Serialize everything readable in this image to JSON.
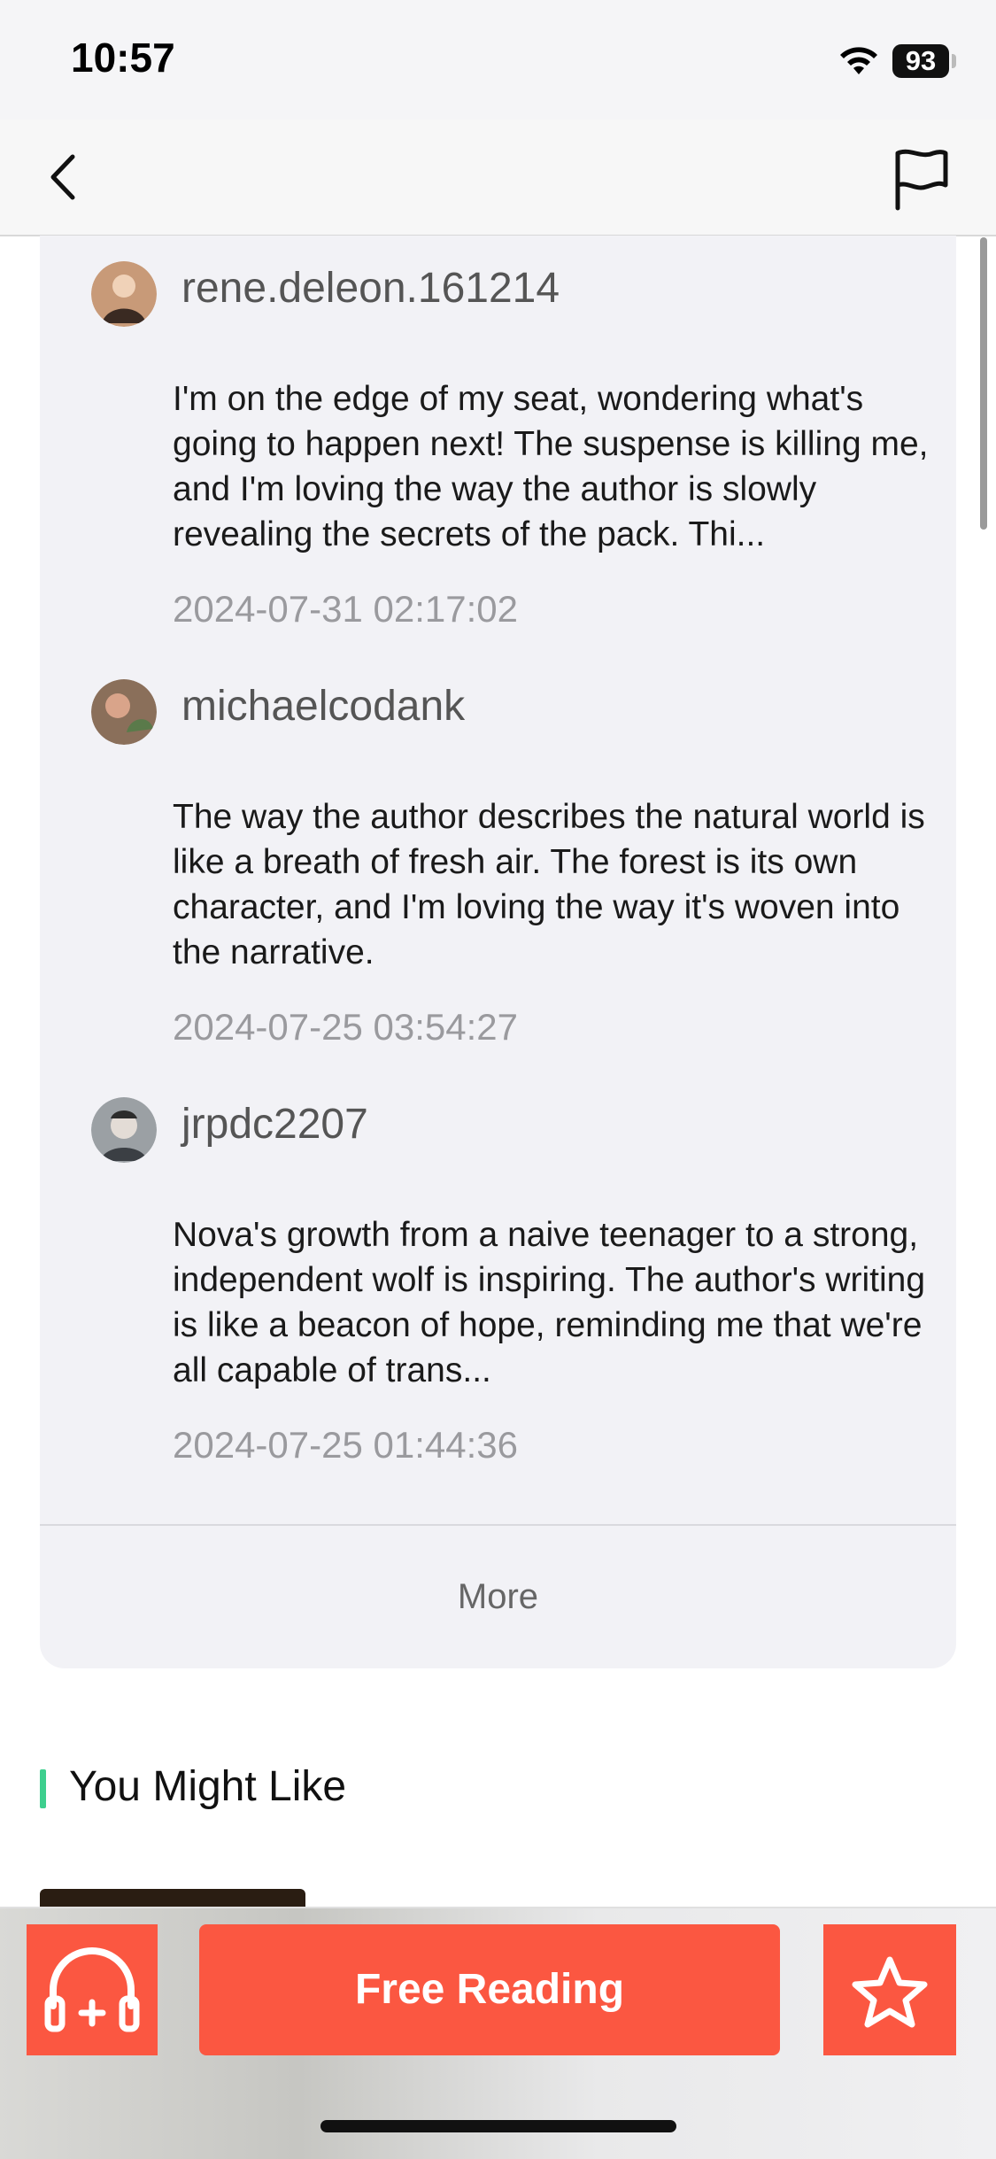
{
  "status_bar": {
    "time": "10:57",
    "battery": "93"
  },
  "comments": [
    {
      "username": "rene.deleon.161214",
      "text": "I'm on the edge of my seat, wondering what's going to happen next! The suspense is killing me, and I'm loving the way the author is slowly revealing the secrets of the pack. Thi...",
      "time": "2024-07-31 02:17:02",
      "avatar_color": "#c89a78"
    },
    {
      "username": "michaelcodank",
      "text": "The way the author describes the natural world is like a breath of fresh air. The forest is its own character, and I'm loving the way it's woven into the narrative.",
      "time": "2024-07-25 03:54:27",
      "avatar_color": "#8a6f5a"
    },
    {
      "username": "jrpdc2207",
      "text": "Nova's growth from a naive teenager to a strong, independent wolf is inspiring. The author's writing is like a beacon of hope, reminding me that we're all capable of trans...",
      "time": "2024-07-25 01:44:36",
      "avatar_color": "#9ba0a4"
    }
  ],
  "more_label": "More",
  "section_title": "You Might Like",
  "bottom_bar": {
    "free_reading_label": "Free Reading"
  },
  "colors": {
    "accent": "#fb5741",
    "section_accent": "#3ecf8e"
  }
}
